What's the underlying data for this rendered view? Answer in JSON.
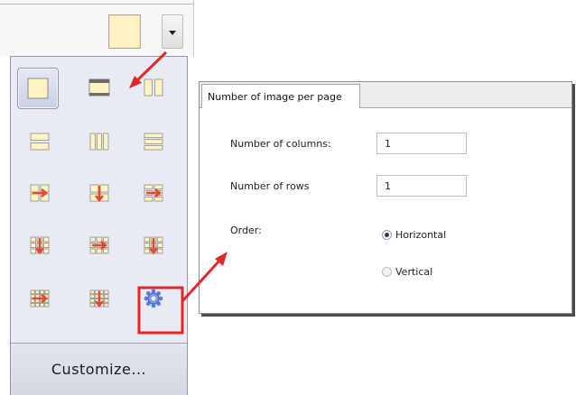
{
  "toolbar": {
    "current_layout_icon": "single-page-layout-icon",
    "dropdown_icon": "chevron-down-icon"
  },
  "layout_menu": {
    "tiles": [
      {
        "icon": "single-page-layout-icon",
        "selected": true
      },
      {
        "icon": "header-bar-layout-icon",
        "selected": false
      },
      {
        "icon": "two-columns-layout-icon",
        "selected": false
      },
      {
        "icon": "two-rows-layout-icon",
        "selected": false
      },
      {
        "icon": "three-columns-layout-icon",
        "selected": false
      },
      {
        "icon": "three-rows-layout-icon",
        "selected": false
      },
      {
        "icon": "grid-2x2-horizontal-order-icon",
        "selected": false
      },
      {
        "icon": "grid-2x2-vertical-order-icon",
        "selected": false
      },
      {
        "icon": "grid-2x3-horizontal-order-icon",
        "selected": false
      },
      {
        "icon": "grid-3x3-vertical-order-icon",
        "selected": false
      },
      {
        "icon": "grid-3x3-horizontal-order-icon",
        "selected": false
      },
      {
        "icon": "grid-3x3-vertical-order-alt-icon",
        "selected": false
      },
      {
        "icon": "grid-4x4-horizontal-order-icon",
        "selected": false
      },
      {
        "icon": "grid-4x4-vertical-order-icon",
        "selected": false
      },
      {
        "icon": "custom-settings-gear-icon",
        "selected": false,
        "highlighted": true
      }
    ],
    "customize_label": "Customize..."
  },
  "dialog": {
    "tab_label": "Number of image per page",
    "columns_label": "Number of columns:",
    "columns_value": "1",
    "rows_label": "Number of rows",
    "rows_value": "1",
    "order_label": "Order:",
    "order_options": [
      {
        "label": "Horizontal",
        "checked": true
      },
      {
        "label": "Vertical",
        "checked": false
      }
    ]
  },
  "colors": {
    "annotation_red": "#e02828",
    "panel_bg": "#e8ebf3",
    "tile_fill": "#fff3c4",
    "tile_border": "#8a8a8a",
    "arrow_red": "#e04a30"
  }
}
